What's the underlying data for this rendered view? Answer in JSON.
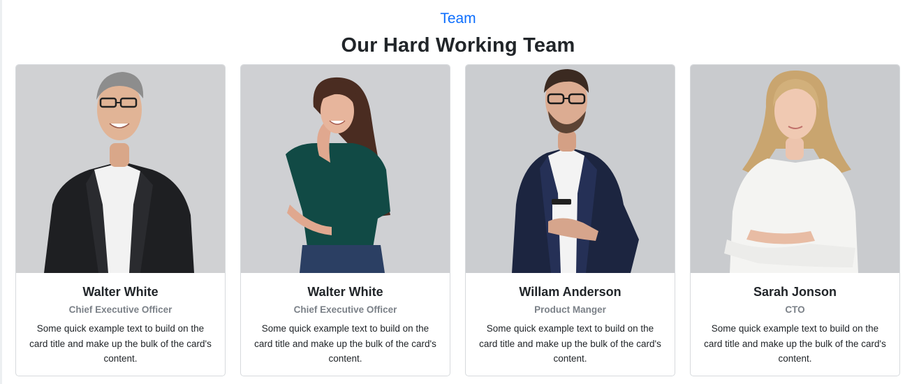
{
  "section": {
    "eyebrow": "Team",
    "title": "Our Hard Working Team"
  },
  "colors": {
    "accent": "#0d6efd",
    "muted_text": "#7b8188",
    "card_border": "#d7dadd",
    "photo_background": "#cfd0d3"
  },
  "team": [
    {
      "name": "Walter White",
      "role": "Chief Executive Officer",
      "description": "Some quick example text to build on the card title and make up the bulk of the card's content."
    },
    {
      "name": "Walter White",
      "role": "Chief Executive Officer",
      "description": "Some quick example text to build on the card title and make up the bulk of the card's content."
    },
    {
      "name": "Willam Anderson",
      "role": "Product Manger",
      "description": "Some quick example text to build on the card title and make up the bulk of the card's content."
    },
    {
      "name": "Sarah Jonson",
      "role": "CTO",
      "description": "Some quick example text to build on the card title and make up the bulk of the card's content."
    }
  ]
}
